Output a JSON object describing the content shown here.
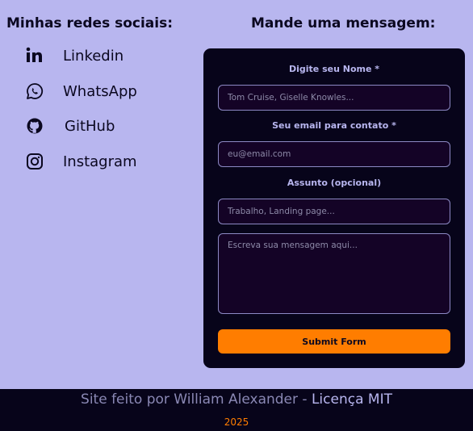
{
  "social": {
    "title": "Minhas redes sociais:",
    "items": [
      {
        "label": "Linkedin",
        "icon": "linkedin-icon"
      },
      {
        "label": "WhatsApp",
        "icon": "whatsapp-icon"
      },
      {
        "label": "GitHub",
        "icon": "github-icon"
      },
      {
        "label": "Instagram",
        "icon": "instagram-icon"
      }
    ]
  },
  "form": {
    "title": "Mande uma mensagem:",
    "name_label": "Digite seu Nome *",
    "name_placeholder": "Tom Cruise, Giselle Knowles...",
    "email_label": "Seu email para contato *",
    "email_placeholder": "eu@email.com",
    "subject_label": "Assunto (opcional)",
    "subject_placeholder": "Trabalho, Landing page...",
    "message_placeholder": "Escreva sua mensagem aqui...",
    "submit_label": "Submit Form"
  },
  "footer": {
    "text": "Site feito por William Alexander - ",
    "license_link": "Licença MIT",
    "year": "2025"
  },
  "colors": {
    "background": "#b8b6ef",
    "card": "#07041a",
    "accent": "#ff7d00",
    "input_bg": "#140326"
  }
}
